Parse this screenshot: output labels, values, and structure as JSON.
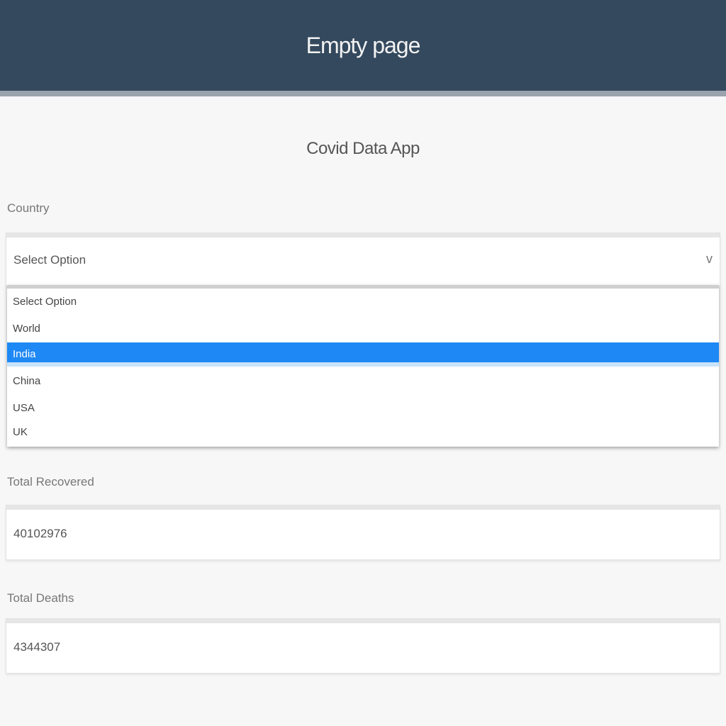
{
  "header": {
    "title": "Empty page"
  },
  "page": {
    "title": "Covid Data App"
  },
  "country": {
    "label": "Country",
    "selected": "Select Option",
    "chevron": "v",
    "options": [
      "Select Option",
      "World",
      "India",
      "China",
      "USA",
      "UK"
    ],
    "highlighted": "India"
  },
  "recovered": {
    "label": "Total Recovered",
    "value": "40102976"
  },
  "deaths": {
    "label": "Total Deaths",
    "value": "4344307"
  },
  "colors": {
    "header_bg": "#34495e",
    "highlight": "#1e88f5",
    "page_bg": "#f7f7f7"
  }
}
